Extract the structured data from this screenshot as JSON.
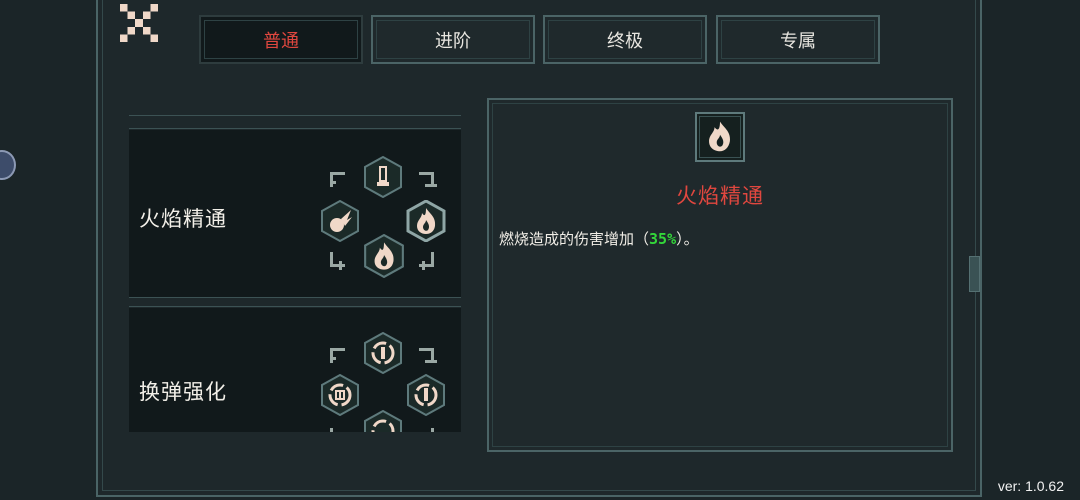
{
  "tabs": [
    {
      "label": "普通",
      "active": true
    },
    {
      "label": "进阶",
      "active": false
    },
    {
      "label": "终极",
      "active": false
    },
    {
      "label": "专属",
      "active": false
    }
  ],
  "skills": [
    {
      "name": "火焰精通",
      "icons": [
        "bullet-flame-icon",
        "flame-icon",
        "fireball-icon",
        "flame-icon"
      ]
    },
    {
      "name": "换弹强化",
      "icons": [
        "reload-icon",
        "reload-icon",
        "reload-icon",
        "reload-icon"
      ]
    }
  ],
  "detail": {
    "title": "火焰精通",
    "desc_prefix": "燃烧造成的伤害增加（",
    "desc_value": "35%",
    "desc_suffix": "）。",
    "icon": "flame-icon"
  },
  "version": "ver: 1.0.62",
  "colors": {
    "accent_red": "#e0473f",
    "highlight_green": "#33d63a",
    "border": "#4b6466",
    "background": "#1e282b"
  }
}
